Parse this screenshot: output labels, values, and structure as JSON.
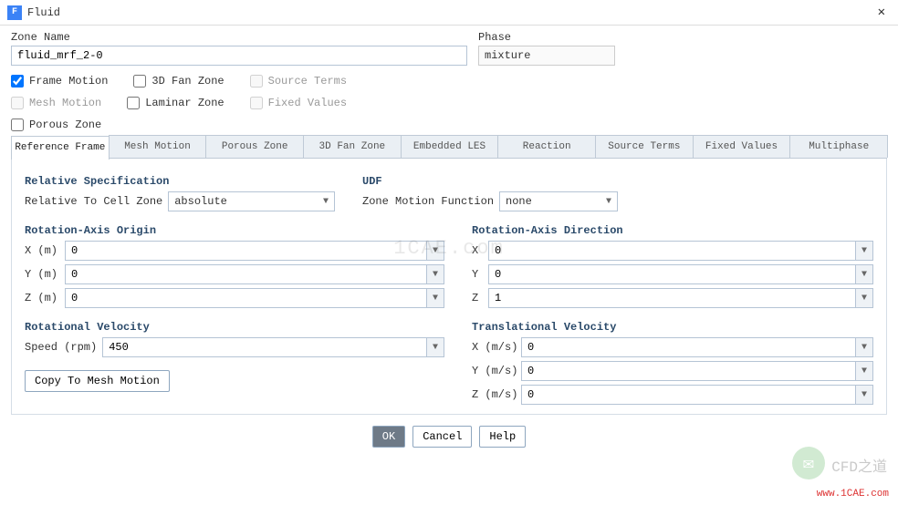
{
  "window": {
    "title": "Fluid",
    "close": "✕"
  },
  "zone_name_label": "Zone Name",
  "zone_name_value": "fluid_mrf_2-0",
  "phase_label": "Phase",
  "phase_value": "mixture",
  "checks": {
    "frame_motion": "Frame Motion",
    "fan_zone": "3D Fan Zone",
    "source_terms": "Source Terms",
    "mesh_motion": "Mesh Motion",
    "laminar_zone": "Laminar Zone",
    "fixed_values": "Fixed Values",
    "porous_zone": "Porous Zone"
  },
  "tabs": [
    "Reference Frame",
    "Mesh Motion",
    "Porous Zone",
    "3D Fan Zone",
    "Embedded LES",
    "Reaction",
    "Source Terms",
    "Fixed Values",
    "Multiphase"
  ],
  "rel_spec_title": "Relative Specification",
  "rel_spec_label": "Relative To Cell Zone",
  "rel_spec_value": "absolute",
  "udf_title": "UDF",
  "udf_label": "Zone Motion Function",
  "udf_value": "none",
  "rot_origin_title": "Rotation-Axis Origin",
  "rot_dir_title": "Rotation-Axis Direction",
  "rot_origin": {
    "x_label": "X (m)",
    "x_val": "0",
    "y_label": "Y (m)",
    "y_val": "0",
    "z_label": "Z (m)",
    "z_val": "0"
  },
  "rot_dir": {
    "x_label": "X",
    "x_val": "0",
    "y_label": "Y",
    "y_val": "0",
    "z_label": "Z",
    "z_val": "1"
  },
  "rot_vel_title": "Rotational Velocity",
  "rot_vel_label": "Speed (rpm)",
  "rot_vel_value": "450",
  "trans_vel_title": "Translational Velocity",
  "trans_vel": {
    "x_label": "X (m/s)",
    "x_val": "0",
    "y_label": "Y (m/s)",
    "y_val": "0",
    "z_label": "Z (m/s)",
    "z_val": "0"
  },
  "copy_btn": "Copy To Mesh Motion",
  "ok": "OK",
  "cancel": "Cancel",
  "help": "Help",
  "wm_center": "1CAE.com",
  "wm_url": "www.1CAE.com",
  "wm_wx": "CFD之道"
}
